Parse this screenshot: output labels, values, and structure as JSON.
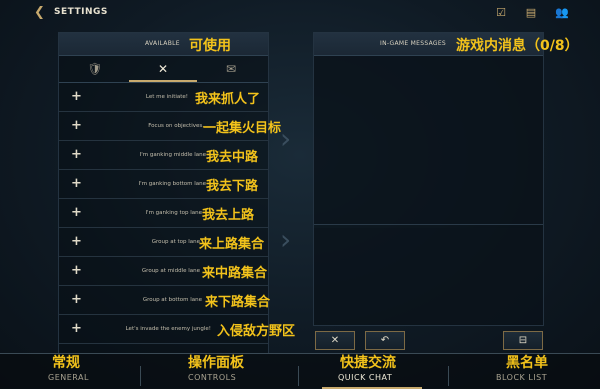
{
  "header": {
    "title": "SETTINGS"
  },
  "available": {
    "label_en": "AVAILABLE",
    "label_cn": "可使用"
  },
  "tabs": [
    "🛡",
    "✕",
    "✉"
  ],
  "phrases": [
    {
      "en": "Let me initiate!",
      "cn": "我来抓人了"
    },
    {
      "en": "Focus on objectives.",
      "cn": "一起集火目标"
    },
    {
      "en": "I'm ganking middle lane",
      "cn": "我去中路"
    },
    {
      "en": "I'm ganking bottom lane",
      "cn": "我去下路"
    },
    {
      "en": "I'm ganking top lane",
      "cn": "我去上路"
    },
    {
      "en": "Group at top lane",
      "cn": "来上路集合"
    },
    {
      "en": "Group at middle lane",
      "cn": "来中路集合"
    },
    {
      "en": "Group at bottom lane",
      "cn": "来下路集合"
    },
    {
      "en": "Let's invade the enemy jungle!",
      "cn": "入侵敌方野区"
    }
  ],
  "messages": {
    "label_en": "IN-GAME MESSAGES",
    "label_cn": "游戏内消息（0/8）"
  },
  "buttons": {
    "delete": "✕",
    "undo": "↶",
    "save": "⊟"
  },
  "nav": [
    {
      "cn": "常规",
      "en": "GENERAL"
    },
    {
      "cn": "操作面板",
      "en": "CONTROLS"
    },
    {
      "cn": "快捷交流",
      "en": "QUICK CHAT"
    },
    {
      "cn": "黑名单",
      "en": "BLOCK LIST"
    }
  ],
  "icons": {
    "back": "chevron-left-icon",
    "top": [
      "checklist-icon",
      "chat-icon",
      "friends-icon"
    ]
  },
  "colors": {
    "accent_gold": "#c8aa6e",
    "annotation_yellow": "#f2c21b"
  }
}
